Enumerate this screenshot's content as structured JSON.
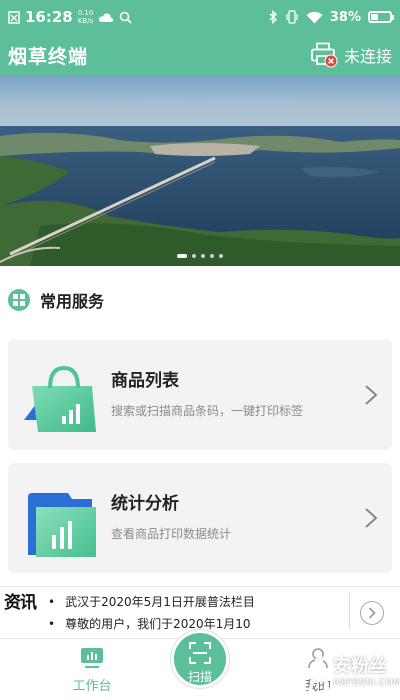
{
  "status_bar": {
    "time": "16:28",
    "net_speed_value": "0.10",
    "net_speed_unit": "KB/s",
    "battery_percent": "38%",
    "battery_level": 0.38
  },
  "app_bar": {
    "title": "烟草终端",
    "connection_status": "未连接"
  },
  "banner": {
    "slide_count": 5,
    "active_slide": 1
  },
  "section": {
    "title": "常用服务"
  },
  "services": [
    {
      "title": "商品列表",
      "desc": "搜索或扫描商品条码，一键打印标签",
      "icon": "shopping-bag-chart-icon"
    },
    {
      "title": "统计分析",
      "desc": "查看商品打印数据统计",
      "icon": "folder-chart-icon"
    }
  ],
  "news": {
    "logo": "资讯",
    "items": [
      "武汉于2020年5月1日开展普法栏目",
      "尊敬的用户，我们于2020年1月10"
    ]
  },
  "tabbar": {
    "workbench": "工作台",
    "scan": "扫描",
    "mine": "我的"
  },
  "watermark": {
    "brand": "安粉丝",
    "site": "ANFENSI.COM"
  },
  "colors": {
    "accent": "#5cbf99",
    "error_badge": "#e0433a"
  }
}
